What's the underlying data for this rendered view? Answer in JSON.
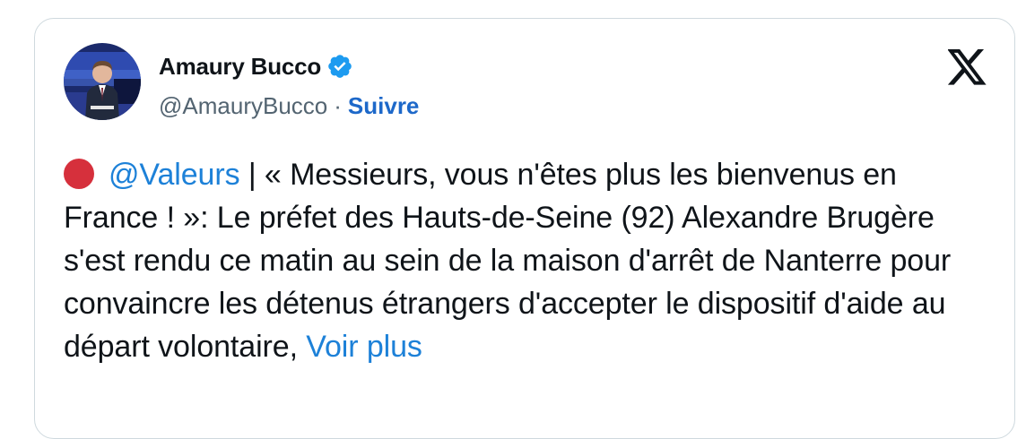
{
  "tweet": {
    "author": {
      "name": "Amaury Bucco",
      "handle": "@AmauryBucco",
      "separator": "·",
      "follow_label": "Suivre"
    },
    "mention": "@Valeurs",
    "text": " | « Messieurs, vous n'êtes plus les bienvenus en France ! »:  Le préfet des Hauts-de-Seine (92) Alexandre Brugère s'est rendu ce matin au sein de la maison d'arrêt de Nanterre pour convaincre les détenus étrangers d'accepter le dispositif d'aide au départ volontaire, ",
    "more_label": "Voir plus"
  },
  "colors": {
    "link": "#1d81d8",
    "follow": "#1d68c9",
    "verified": "#1d9bf0",
    "red_dot": "#d6303c"
  },
  "icons": {
    "verified": "verified-badge-icon",
    "logo": "x-logo-icon",
    "bullet": "red-circle-emoji"
  }
}
